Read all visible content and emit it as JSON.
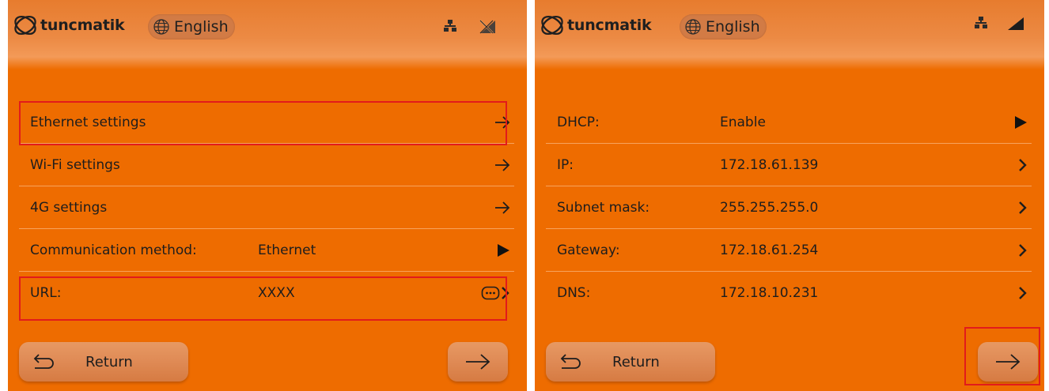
{
  "screens": [
    {
      "brand": "tuncmatik",
      "language": "English",
      "rows": [
        {
          "label": "Ethernet settings",
          "value": "",
          "action": "arrow-right"
        },
        {
          "label": "Wi-Fi settings",
          "value": "",
          "action": "arrow-right"
        },
        {
          "label": "4G settings",
          "value": "",
          "action": "arrow-right"
        },
        {
          "label": "Communication method:",
          "value": "Ethernet",
          "action": "play"
        },
        {
          "label": "URL:",
          "value": "XXXX",
          "action": "keyboard-chevron"
        }
      ],
      "return_label": "Return"
    },
    {
      "brand": "tuncmatik",
      "language": "English",
      "rows": [
        {
          "label": "DHCP:",
          "value": "Enable",
          "action": "play"
        },
        {
          "label": "IP:",
          "value": "172.18.61.139",
          "action": "chevron"
        },
        {
          "label": "Subnet mask:",
          "value": "255.255.255.0",
          "action": "chevron"
        },
        {
          "label": "Gateway:",
          "value": "172.18.61.254",
          "action": "chevron"
        },
        {
          "label": "DNS:",
          "value": "172.18.10.231",
          "action": "chevron"
        }
      ],
      "return_label": "Return"
    }
  ],
  "icons": {
    "logo": "tuncmatik-logo-icon",
    "globe": "globe-icon",
    "network": "network-icon",
    "no_signal": "no-signal-icon",
    "signal": "signal-strength-icon",
    "arrow_right": "arrow-right-icon",
    "play": "play-icon",
    "chevron": "chevron-right-icon",
    "keyboard": "keyboard-icon",
    "return": "return-icon"
  },
  "colors": {
    "background": "#ee6c00",
    "highlight": "#e21b1b",
    "button": "#df8a55",
    "text": "#1d1d1d"
  }
}
